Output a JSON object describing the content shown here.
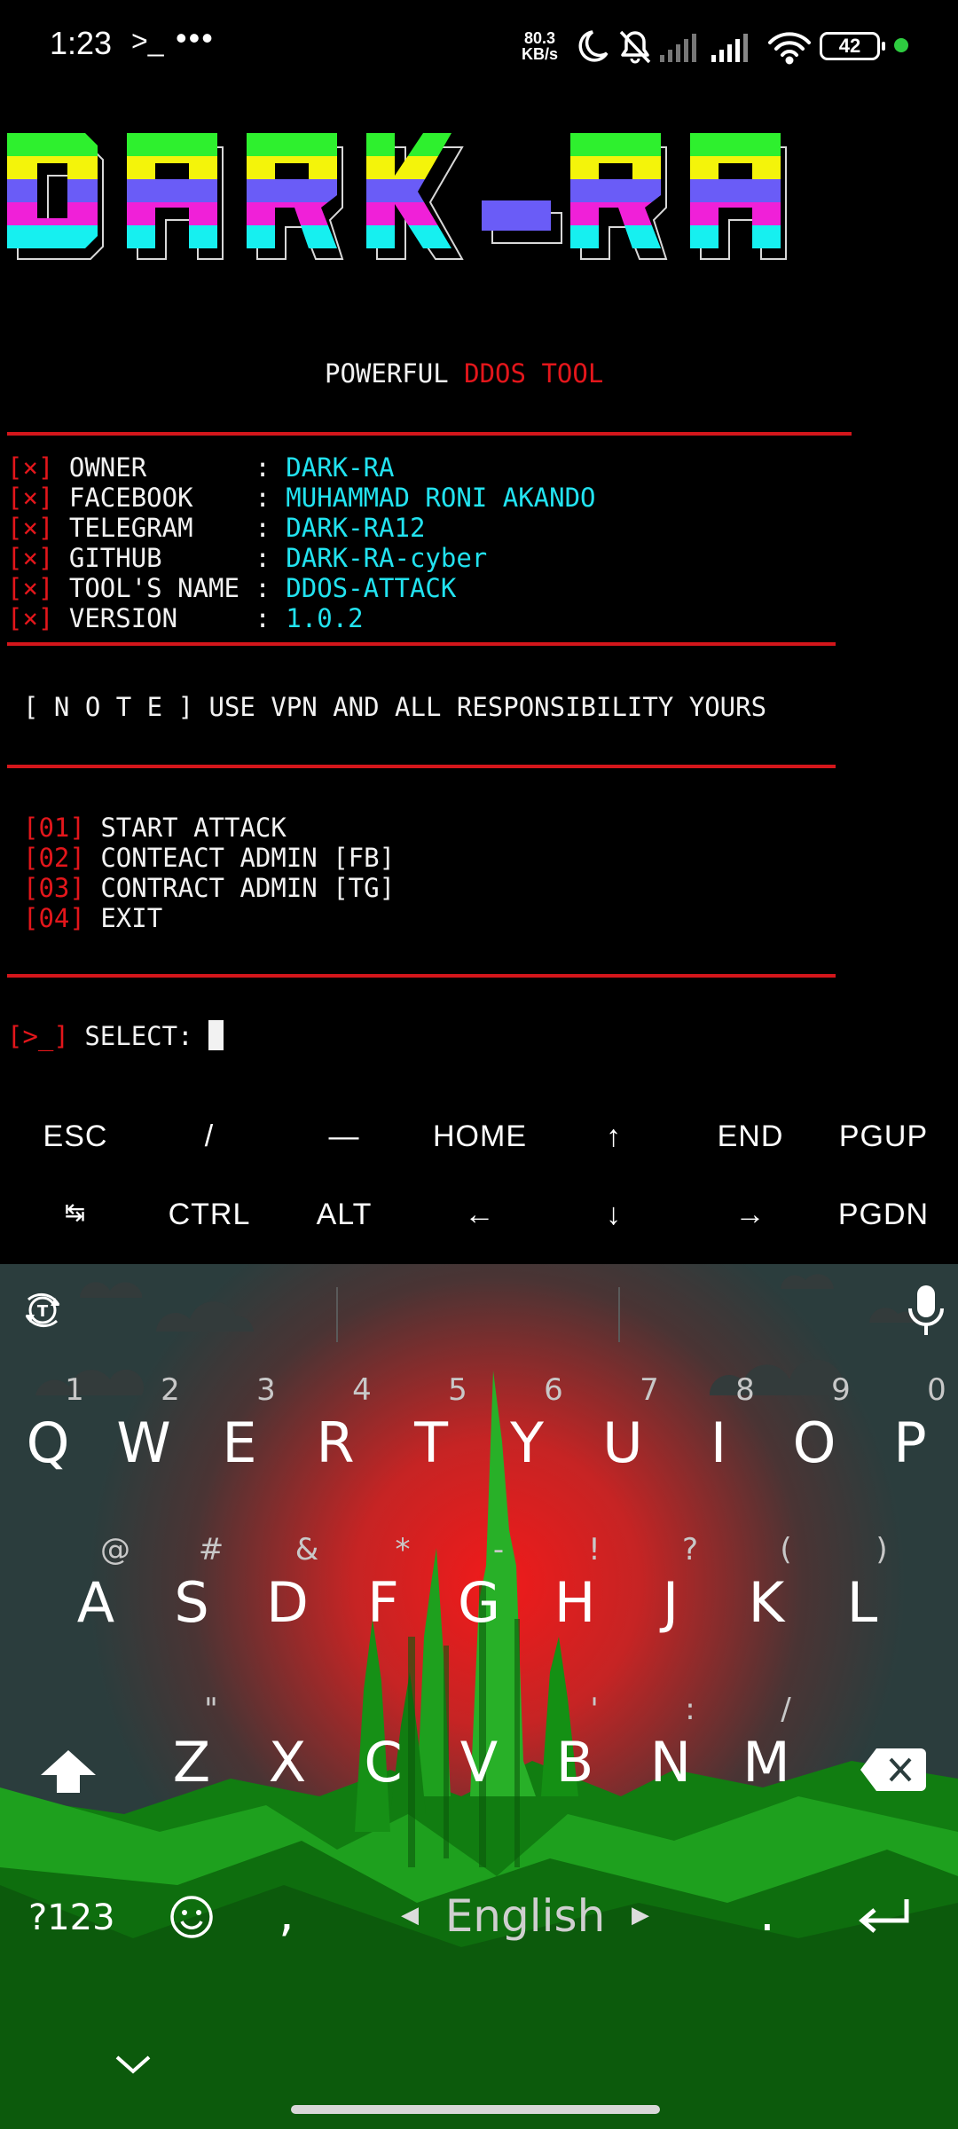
{
  "status_bar": {
    "time": "1:23",
    "terminal_glyph": ">_",
    "overflow": "•••",
    "net_speed_value": "80.3",
    "net_speed_unit": "KB/s",
    "battery": "42"
  },
  "banner": {
    "art_text": "DARK-RA",
    "subtitle_a": "POWERFUL ",
    "subtitle_b": "DDOS TOOL"
  },
  "info": [
    {
      "mark": "[×]",
      "label": "OWNER       ",
      "sep": ": ",
      "value": "DARK-RA"
    },
    {
      "mark": "[×]",
      "label": "FACEBOOK    ",
      "sep": ": ",
      "value": "MUHAMMAD RONI AKANDO"
    },
    {
      "mark": "[×]",
      "label": "TELEGRAM    ",
      "sep": ": ",
      "value": "DARK-RA12"
    },
    {
      "mark": "[×]",
      "label": "GITHUB      ",
      "sep": ": ",
      "value": "DARK-RA-cyber"
    },
    {
      "mark": "[×]",
      "label": "TOOL'S NAME ",
      "sep": ": ",
      "value": "DDOS-ATTACK"
    },
    {
      "mark": "[×]",
      "label": "VERSION     ",
      "sep": ": ",
      "value": "1.0.2"
    }
  ],
  "note": "[ N O T E ] USE VPN AND ALL RESPONSIBILITY YOURS",
  "menu": [
    {
      "num": "[01]",
      "label": "START ATTACK"
    },
    {
      "num": "[02]",
      "label": "CONTEACT ADMIN [FB]"
    },
    {
      "num": "[03]",
      "label": "CONTRACT ADMIN [TG]"
    },
    {
      "num": "[04]",
      "label": "EXIT"
    }
  ],
  "prompt": {
    "glyph": "[>_]",
    "text": "SELECT: "
  },
  "extra_keys": {
    "row1": [
      "ESC",
      "/",
      "—",
      "HOME",
      "↑",
      "END",
      "PGUP"
    ],
    "row2": [
      "↹",
      "CTRL",
      "ALT",
      "←",
      "↓",
      "→",
      "PGDN"
    ]
  },
  "keyboard": {
    "row1": [
      "Q",
      "W",
      "E",
      "R",
      "T",
      "Y",
      "U",
      "I",
      "O",
      "P"
    ],
    "row1_hints": [
      "1",
      "2",
      "3",
      "4",
      "5",
      "6",
      "7",
      "8",
      "9",
      "0"
    ],
    "row2": [
      "A",
      "S",
      "D",
      "F",
      "G",
      "H",
      "J",
      "K",
      "L"
    ],
    "row2_hints": [
      "@",
      "#",
      "&",
      "*",
      "-",
      "!",
      "?",
      "(",
      ")"
    ],
    "row3": [
      "Z",
      "X",
      "C",
      "V",
      "B",
      "N",
      "M"
    ],
    "row3_hints": [
      "\"",
      "",
      "",
      "",
      "'",
      ":",
      "/"
    ],
    "symbols_label": "?123",
    "comma": ",",
    "language": "English",
    "period": ".",
    "colors": {
      "sky": "#2b3d3d",
      "sun": "#e02020",
      "hills": "#1a9a1a"
    }
  }
}
